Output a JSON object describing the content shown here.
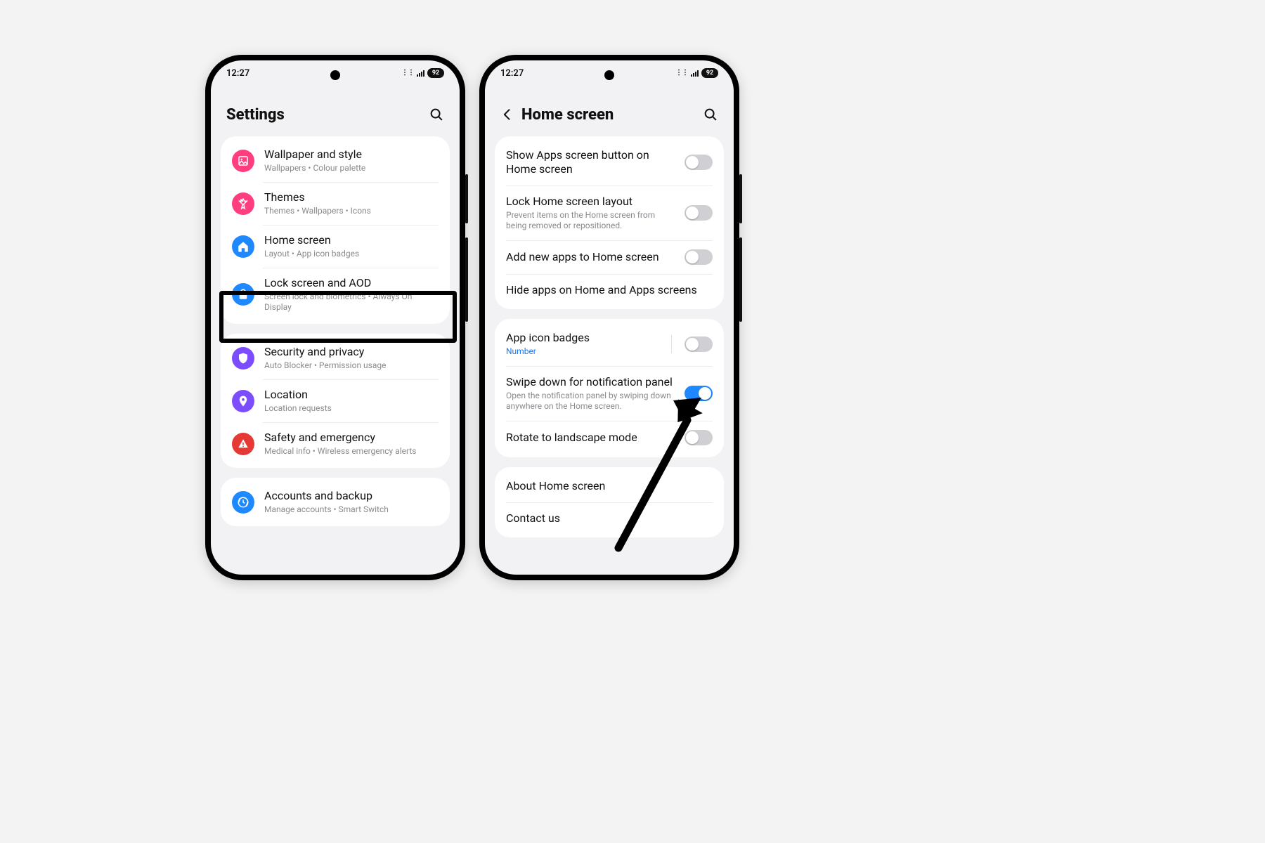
{
  "status": {
    "time": "12:27",
    "battery": "92"
  },
  "phone1": {
    "title": "Settings",
    "groups": [
      {
        "rows": [
          {
            "icon": "wallpaper",
            "color": "#ff3d7f",
            "title": "Wallpaper and style",
            "sub": "Wallpapers  •  Colour palette"
          },
          {
            "icon": "themes",
            "color": "#ff3d7f",
            "title": "Themes",
            "sub": "Themes  •  Wallpapers  •  Icons"
          },
          {
            "icon": "home",
            "color": "#1e88ff",
            "title": "Home screen",
            "sub": "Layout  •  App icon badges",
            "highlight": true
          },
          {
            "icon": "lock",
            "color": "#1e88ff",
            "title": "Lock screen and AOD",
            "sub": "Screen lock and biometrics  •  Always On Display"
          }
        ]
      },
      {
        "rows": [
          {
            "icon": "shield",
            "color": "#7c4dff",
            "title": "Security and privacy",
            "sub": "Auto Blocker  •  Permission usage"
          },
          {
            "icon": "location",
            "color": "#7c4dff",
            "title": "Location",
            "sub": "Location requests"
          },
          {
            "icon": "safety",
            "color": "#e53935",
            "title": "Safety and emergency",
            "sub": "Medical info  •  Wireless emergency alerts"
          }
        ]
      },
      {
        "rows": [
          {
            "icon": "accounts",
            "color": "#1e88ff",
            "title": "Accounts and backup",
            "sub": "Manage accounts  •  Smart Switch"
          }
        ]
      }
    ]
  },
  "phone2": {
    "title": "Home screen",
    "groups": [
      {
        "rows": [
          {
            "title": "Show Apps screen button on Home screen",
            "switch": "off"
          },
          {
            "title": "Lock Home screen layout",
            "sub": "Prevent items on the Home screen from being removed or repositioned.",
            "switch": "off"
          },
          {
            "title": "Add new apps to Home screen",
            "switch": "off"
          },
          {
            "title": "Hide apps on Home and Apps screens"
          }
        ]
      },
      {
        "rows": [
          {
            "title": "App icon badges",
            "subLink": "Number",
            "switch": "off",
            "divider": true
          },
          {
            "title": "Swipe down for notification panel",
            "sub": "Open the notification panel by swiping down anywhere on the Home screen.",
            "switch": "on"
          },
          {
            "title": "Rotate to landscape mode",
            "switch": "off"
          }
        ]
      },
      {
        "rows": [
          {
            "title": "About Home screen"
          },
          {
            "title": "Contact us"
          }
        ]
      }
    ]
  }
}
